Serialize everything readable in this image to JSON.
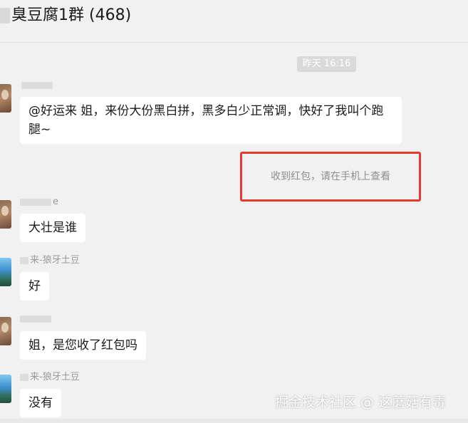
{
  "chat": {
    "title": "臭豆腐1群 (468)",
    "timestamp": "昨天 16:16"
  },
  "messages": [
    {
      "nickname": "",
      "text": "@好运来 姐，来份大份黑白拼，黑多白少正常调，快好了我叫个跑腿~"
    },
    {
      "nickname": "e",
      "text": "大壮是谁"
    },
    {
      "nickname": "来-狼牙土豆",
      "text": "好"
    },
    {
      "nickname": "",
      "text": "姐，是您收了红包吗"
    },
    {
      "nickname": "来-狼牙土豆",
      "text": "没有"
    }
  ],
  "system_notice": "收到红包，请在手机上查看",
  "watermark": "掘金技术社区 @ 这蘑菇有毒",
  "colors": {
    "background": "#f1f1f1",
    "bubble": "#ffffff",
    "highlight_box": "#e53a30",
    "timestamp_bg": "#dadada"
  }
}
